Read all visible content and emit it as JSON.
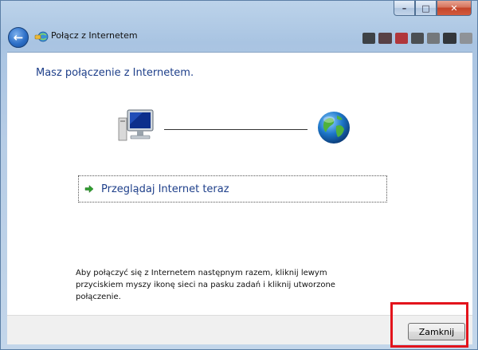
{
  "window": {
    "title": "Połącz z Internetem",
    "caption_min": "–",
    "caption_max": "□",
    "caption_close": "✕",
    "back_glyph": "←"
  },
  "main": {
    "heading": "Masz połączenie z Internetem.",
    "browse_link": "Przeglądaj Internet teraz",
    "info_text": "Aby połączyć się z Internetem następnym razem, kliknij lewym przyciskiem myszy ikonę sieci na pasku zadań i kliknij utworzone połączenie."
  },
  "footer": {
    "close_label": "Zamknij"
  },
  "icons": {
    "back": "back-arrow-icon",
    "title": "network-connection-icon",
    "computer": "computer-icon",
    "globe": "globe-icon",
    "link_arrow": "green-arrow-icon"
  },
  "colors": {
    "heading": "#1e3f8a",
    "highlight": "#e3141c",
    "frame": "#b7cde6",
    "close_caption": "#c4452a"
  }
}
